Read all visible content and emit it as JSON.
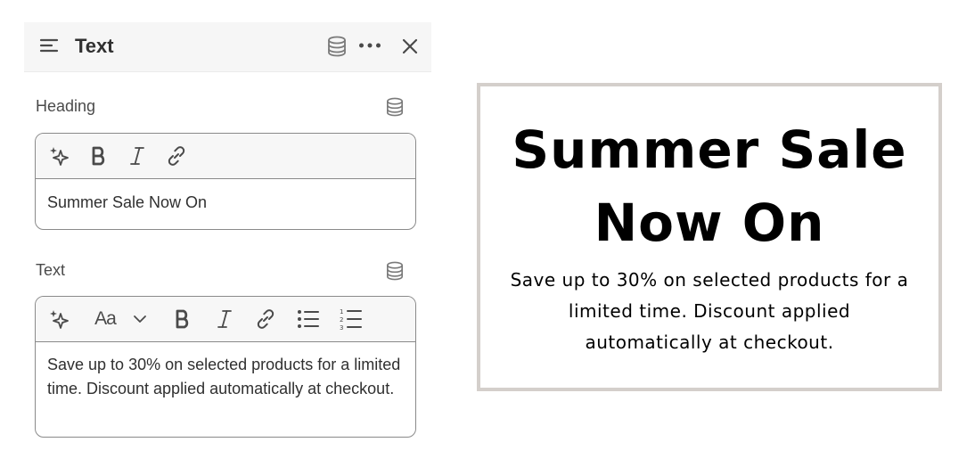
{
  "panel": {
    "title": "Text",
    "header_icons": [
      "text-align-icon",
      "database-icon",
      "more-icon",
      "close-icon"
    ]
  },
  "heading_field": {
    "label": "Heading",
    "value": "Summer Sale Now On",
    "toolbar": [
      "sparkle-icon",
      "bold-icon",
      "italic-icon",
      "link-icon"
    ]
  },
  "text_field": {
    "label": "Text",
    "font_button": "Aa",
    "value": "Save up to 30% on selected products for a limited time. Discount applied automatically at checkout.",
    "toolbar": [
      "sparkle-icon",
      "font-size-icon",
      "chevron-down-icon",
      "bold-icon",
      "italic-icon",
      "link-icon",
      "bullet-list-icon",
      "numbered-list-icon"
    ]
  },
  "preview": {
    "heading": "Summer Sale Now On",
    "text": "Save up to 30% on selected products for a limited time. Discount applied automatically at checkout.",
    "border_color": "#d4cfcb"
  },
  "colors": {
    "header_bg": "#f6f6f6",
    "text": "#303030",
    "border": "#8a8a8a"
  }
}
